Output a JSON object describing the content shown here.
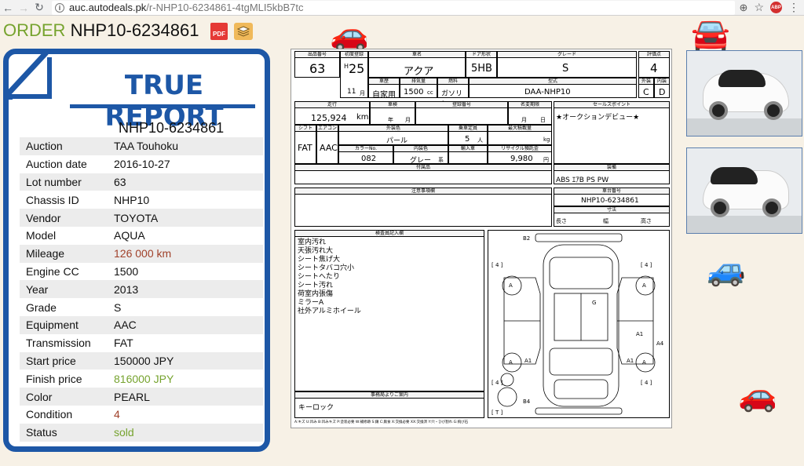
{
  "browser": {
    "url_host": "auc.autodeals.pk",
    "url_path": "/r-NHP10-6234861-4tgMLI5kbB7tc",
    "abp_label": "ABP"
  },
  "order": {
    "label": "ORDER",
    "number": "NHP10-6234861",
    "pdf_label": "PDF"
  },
  "report": {
    "banner": "TRUE REPORT",
    "id": "NHP10-6234861",
    "rows": [
      {
        "key": "Auction",
        "value": "TAA Touhoku",
        "style": ""
      },
      {
        "key": "Auction date",
        "value": "2016-10-27",
        "style": ""
      },
      {
        "key": "Lot number",
        "value": "63",
        "style": ""
      },
      {
        "key": "Chassis ID",
        "value": "NHP10",
        "style": ""
      },
      {
        "key": "Vendor",
        "value": "TOYOTA",
        "style": ""
      },
      {
        "key": "Model",
        "value": "AQUA",
        "style": ""
      },
      {
        "key": "Mileage",
        "value": "126 000 km",
        "style": "red"
      },
      {
        "key": "Engine CC",
        "value": "1500",
        "style": ""
      },
      {
        "key": "Year",
        "value": "2013",
        "style": ""
      },
      {
        "key": "Grade",
        "value": "S",
        "style": ""
      },
      {
        "key": "Equipment",
        "value": "AAC",
        "style": ""
      },
      {
        "key": "Transmission",
        "value": "FAT",
        "style": ""
      },
      {
        "key": "Start price",
        "value": "150000 JPY",
        "style": ""
      },
      {
        "key": "Finish price",
        "value": "816000 JPY",
        "style": "green"
      },
      {
        "key": "Color",
        "value": "PEARL",
        "style": ""
      },
      {
        "key": "Condition",
        "value": "4",
        "style": "red"
      },
      {
        "key": "Status",
        "value": "sold",
        "style": "green"
      }
    ]
  },
  "sheet": {
    "lot_hdr": "出品番号",
    "lot": "63",
    "reg_hdr": "初度登録",
    "reg_era": "H",
    "reg_year": "25",
    "reg_month": "11",
    "reg_month_unit": "月",
    "name_hdr": "車名",
    "name": "アクア",
    "door_hdr": "ドア形状",
    "door": "5HB",
    "grade_hdr": "グレード",
    "grade": "S",
    "score_hdr": "評価点",
    "score": "4",
    "ext_hdr": "外装",
    "ext": "C",
    "int_hdr": "内装",
    "int": "D",
    "history_hdr": "車歴",
    "history": "自家用",
    "cc_hdr": "排気量",
    "cc": "1500",
    "cc_unit": "cc",
    "fuel_hdr": "燃料",
    "fuel": "ガソリン",
    "model_hdr": "型式",
    "model": "DAA-NHP10",
    "mileage_hdr": "走行",
    "mileage": "125,924",
    "mileage_unit": "km",
    "inspection_hdr": "車検",
    "inspection_year": "年",
    "inspection_month": "月",
    "regno_hdr": "登録番号",
    "transfer_hdr": "名変期限",
    "transfer_month": "月",
    "transfer_day": "日",
    "sales_hdr": "セールスポイント",
    "sales": "★オークションデビュー★",
    "shift_hdr": "シフト",
    "shift": "FAT",
    "ac_hdr": "エアコン",
    "ac": "AAC",
    "color_hdr": "外装色",
    "color": "パール",
    "seats_hdr": "乗車定員",
    "seats": "5",
    "seats_unit": "人",
    "load_hdr": "最大積載量",
    "load_unit": "kg",
    "colorno_hdr": "カラーNo.",
    "colorno": "082",
    "intcolor_hdr": "内装色",
    "intcolor": "グレー",
    "intcolor_unit": "系",
    "import_hdr": "輸入車",
    "recycle_hdr": "リサイクル預託金",
    "recycle": "9,980",
    "recycle_unit": "円",
    "parts_hdr": "付属品",
    "equip_hdr": "装備",
    "equip": "ABS ｴｱB PS PW",
    "notes_hdr": "注意事項欄",
    "chassis_hdr": "車台番号",
    "chassis": "NHP10-6234861",
    "dims_hdr": "寸法",
    "len": "長さ",
    "width": "幅",
    "height": "高さ",
    "inspector_hdr": "検査員記入欄",
    "inspector_lines": [
      "室内汚れ",
      "天張汚れ大",
      "シート焦げ大",
      "シートタバコ穴小",
      "シートへたり",
      "シート汚れ",
      "荷室内張傷",
      "ミラーA",
      "社外アルミホイール"
    ],
    "office_hdr": "事務局よりご案内",
    "office": "キーロック",
    "legend": "A:キズ U:凹み B:凹みキズ P:塗装必要 W:補修跡 S:錆 C:腐食 X:交換必要 XX:交換済 Y:穴・ひび割れ G:飛び石"
  },
  "diagram": {
    "b2": "B2",
    "b4": "B4",
    "g": "G",
    "a": "A",
    "a1": "A1",
    "a4": "A4",
    "four": "[ 4 ]",
    "t": "[ T ]"
  }
}
